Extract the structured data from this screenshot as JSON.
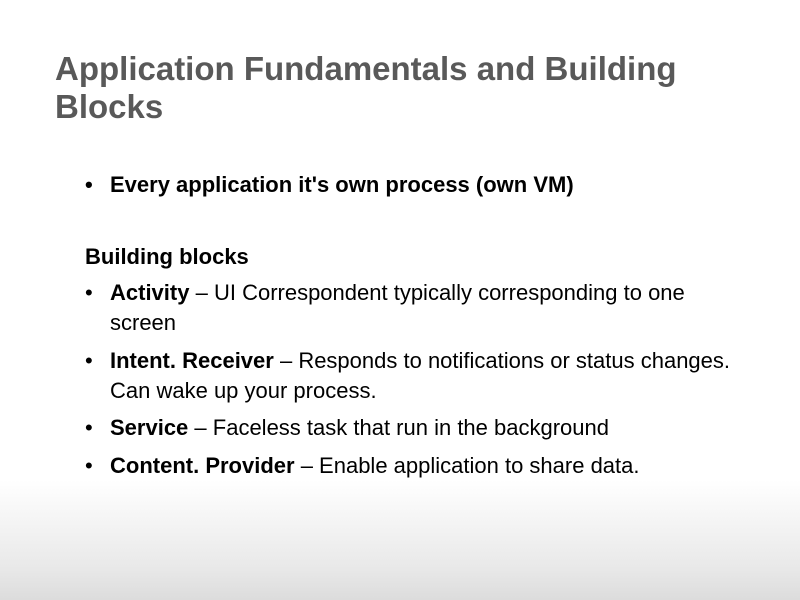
{
  "slide": {
    "title": "Application Fundamentals and Building Blocks",
    "main_bullet": "Every application it's own process (own VM)",
    "subheading": "Building blocks",
    "items": [
      {
        "term": "Activity",
        "sep": " – ",
        "desc": "UI Correspondent typically corresponding to one screen"
      },
      {
        "term": "Intent. Receiver",
        "sep": " – ",
        "desc": "Responds to notifications or status changes. Can wake up your process."
      },
      {
        "term": "Service",
        "sep": " – ",
        "desc": "Faceless task that run in the background"
      },
      {
        "term": "Content. Provider",
        "sep": " – ",
        "desc": "Enable application to share data."
      }
    ]
  }
}
